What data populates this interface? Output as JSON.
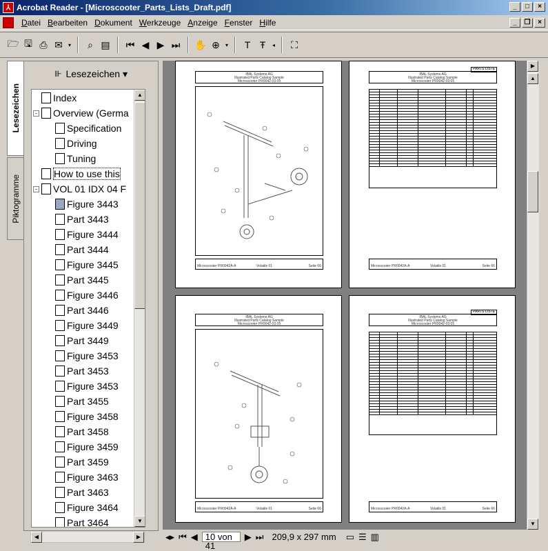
{
  "window": {
    "title": "Acrobat Reader - [Microscooter_Parts_Lists_Draft.pdf]",
    "controls": [
      "_",
      "□",
      "×"
    ],
    "doc_controls": [
      "_",
      "🗗",
      "×"
    ]
  },
  "menu": [
    "Datei",
    "Bearbeiten",
    "Dokument",
    "Werkzeuge",
    "Anzeige",
    "Fenster",
    "Hilfe"
  ],
  "toolbar": {
    "icons": [
      "open-icon",
      "save-icon",
      "print-icon",
      "email-icon",
      "search-icon",
      "show-hide-navigation-icon",
      "first-page-icon",
      "previous-page-icon",
      "next-page-icon",
      "last-page-icon",
      "hand-tool-icon",
      "zoom-in-icon",
      "text-select-icon",
      "column-select-icon",
      "graphics-select-icon"
    ]
  },
  "side_tabs": [
    "Lesezeichen",
    "Piktogramme"
  ],
  "panel": {
    "title": "Lesezeichen ▾"
  },
  "bookmarks": [
    {
      "label": "Index",
      "level": 0,
      "expander": ""
    },
    {
      "label": "Overview (Germa",
      "level": 0,
      "expander": "-"
    },
    {
      "label": "Specification",
      "level": 1,
      "expander": ""
    },
    {
      "label": "Driving",
      "level": 1,
      "expander": ""
    },
    {
      "label": "Tuning",
      "level": 1,
      "expander": ""
    },
    {
      "label": "How to use this",
      "level": 0,
      "expander": "",
      "selected": true
    },
    {
      "label": "VOL 01 IDX 04 F",
      "level": 0,
      "expander": "-"
    },
    {
      "label": "Figure 3443",
      "level": 1,
      "expander": "",
      "grey": true
    },
    {
      "label": "Part 3443",
      "level": 1,
      "expander": ""
    },
    {
      "label": "Figure 3444",
      "level": 1,
      "expander": ""
    },
    {
      "label": "Part 3444",
      "level": 1,
      "expander": ""
    },
    {
      "label": "Figure 3445",
      "level": 1,
      "expander": ""
    },
    {
      "label": "Part 3445",
      "level": 1,
      "expander": ""
    },
    {
      "label": "Figure 3446",
      "level": 1,
      "expander": ""
    },
    {
      "label": "Part 3446",
      "level": 1,
      "expander": ""
    },
    {
      "label": "Figure 3449",
      "level": 1,
      "expander": ""
    },
    {
      "label": "Part 3449",
      "level": 1,
      "expander": ""
    },
    {
      "label": "Figure 3453",
      "level": 1,
      "expander": ""
    },
    {
      "label": "Part 3453",
      "level": 1,
      "expander": ""
    },
    {
      "label": "Figure 3453",
      "level": 1,
      "expander": ""
    },
    {
      "label": "Part 3455",
      "level": 1,
      "expander": ""
    },
    {
      "label": "Figure 3458",
      "level": 1,
      "expander": ""
    },
    {
      "label": "Part 3458",
      "level": 1,
      "expander": ""
    },
    {
      "label": "Figure 3459",
      "level": 1,
      "expander": ""
    },
    {
      "label": "Part 3459",
      "level": 1,
      "expander": ""
    },
    {
      "label": "Figure 3463",
      "level": 1,
      "expander": ""
    },
    {
      "label": "Part 3463",
      "level": 1,
      "expander": ""
    },
    {
      "label": "Figure 3464",
      "level": 1,
      "expander": ""
    },
    {
      "label": "Part 3464",
      "level": 1,
      "expander": ""
    }
  ],
  "pages": {
    "header_lines": [
      "IBAL Systems AG",
      "Illustrated Parts Catalog Sample",
      "Microscooter PR0042-03.05"
    ],
    "parts_list_label": "PARTS LISTE",
    "footer_left": "Microscooter PR0042A-A",
    "footer_mid": "Volatile 01",
    "footer_right": "Seite 66"
  },
  "status": {
    "page_field": "10 von 41",
    "page_size": "209,9 x 297 mm"
  }
}
